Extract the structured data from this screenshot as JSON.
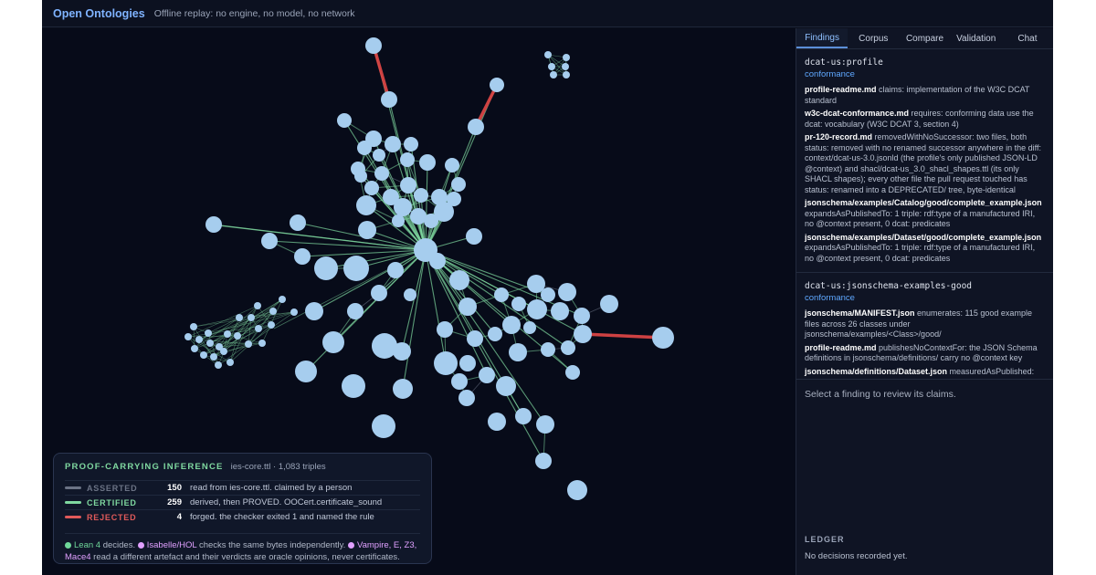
{
  "header": {
    "brand": "Open Ontologies",
    "subtitle": "Offline replay: no engine, no model, no network"
  },
  "tabs": [
    {
      "label": "Findings",
      "active": true
    },
    {
      "label": "Corpus"
    },
    {
      "label": "Compare"
    },
    {
      "label": "Validation"
    },
    {
      "label": "Chat"
    }
  ],
  "findings": [
    {
      "title": "dcat-us:profile",
      "tag": "conformance",
      "items": [
        {
          "file": "profile-readme.md",
          "text": " claims: implementation of the W3C DCAT standard"
        },
        {
          "file": "w3c-dcat-conformance.md",
          "text": " requires: conforming data use the dcat: vocabulary (W3C DCAT 3, section 4)"
        },
        {
          "file": "pr-120-record.md",
          "text": " removedWithNoSuccessor: two files, both status: removed with no renamed successor anywhere in the diff: context/dcat-us-3.0.jsonld (the profile's only published JSON-LD @context) and shacl/dcat-us_3.0_shacl_shapes.ttl (its only SHACL shapes); every other file the pull request touched has status: renamed into a DEPRECATED/ tree, byte-identical"
        },
        {
          "file": "jsonschema/examples/Catalog/good/complete_example.json",
          "text": " expandsAsPublishedTo: 1 triple: rdf:type of a manufactured IRI, no @context present, 0 dcat: predicates"
        },
        {
          "file": "jsonschema/examples/Dataset/good/complete_example.json",
          "text": " expandsAsPublishedTo: 1 triple: rdf:type of a manufactured IRI, no @context present, 0 dcat: predicates"
        }
      ]
    },
    {
      "title": "dcat-us:jsonschema-examples-good",
      "tag": "conformance",
      "items": [
        {
          "file": "jsonschema/MANIFEST.json",
          "text": " enumerates: 115 good example files across 26 classes under jsonschema/examples/<Class>/good/"
        },
        {
          "file": "profile-readme.md",
          "text": " publishesNoContextFor: the JSON Schema definitions in jsonschema/definitions/ carry no @context key"
        },
        {
          "file": "jsonschema/definitions/Dataset.json",
          "text": " measuredAsPublished:"
        }
      ]
    }
  ],
  "hint": "Select a finding to review its claims.",
  "ledger": {
    "title": "LEDGER",
    "text": "No decisions recorded yet."
  },
  "legend": {
    "title": "PROOF-CARRYING INFERENCE",
    "source": "ies-core.ttl · 1,083 triples",
    "rows": [
      {
        "kind": "ASSERTED",
        "count": "150",
        "desc": "read from ies-core.ttl. claimed by a person",
        "color": "#6b7385"
      },
      {
        "kind": "CERTIFIED",
        "count": "259",
        "desc": "derived, then PROVED. OOCert.certificate_sound",
        "color": "#7fd8a0"
      },
      {
        "kind": "REJECTED",
        "count": "4",
        "desc": "forged. the checker exited 1 and named the rule",
        "color": "#e05a5a"
      }
    ],
    "foot": {
      "lean": "Lean 4",
      "lean_text": " decides. ",
      "isabelle": "Isabelle/HOL",
      "isabelle_text": " checks the same bytes independently. ",
      "others": "Vampire, E, Z3, Mace4",
      "others_text": " read a different artefact and their verdicts are oracle opinions, never certificates."
    }
  },
  "colors": {
    "node": "#a6cdee",
    "certified_edge": "#7fd8a0",
    "asserted_edge": "#6b7385",
    "rejected_edge": "#d94545"
  }
}
